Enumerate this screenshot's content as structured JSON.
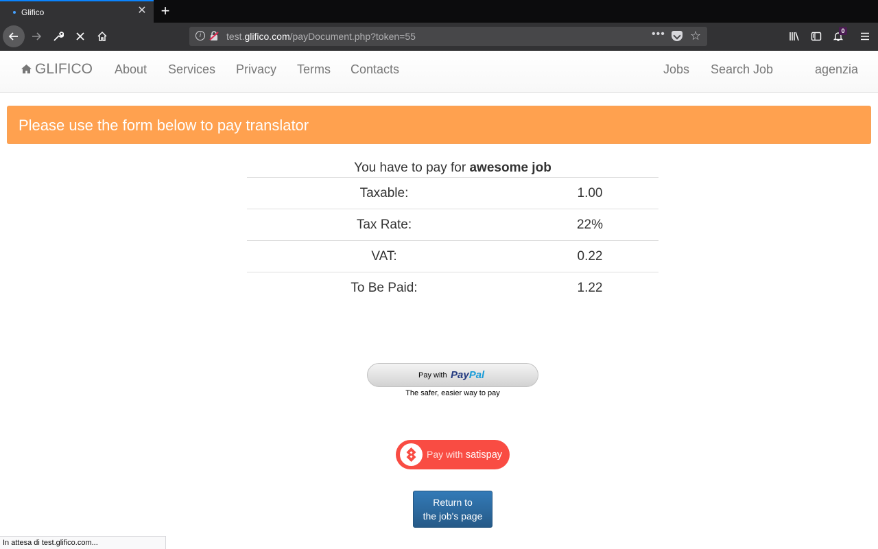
{
  "browser": {
    "tab_title": "Glifico",
    "url_prefix": "test.",
    "url_domain": "glifico.com",
    "url_path": "/payDocument.php?token=55",
    "notification_count": "0",
    "status_text": "In attesa di test.glifico.com..."
  },
  "nav": {
    "brand": "GLIFICO",
    "links": [
      "About",
      "Services",
      "Privacy",
      "Terms",
      "Contacts"
    ],
    "right_links": [
      "Jobs",
      "Search Job",
      "agenzia"
    ]
  },
  "alert": {
    "message": "Please use the form below to pay translator"
  },
  "payment": {
    "heading_prefix": "You have to pay for ",
    "job_name": "awesome job",
    "rows": [
      {
        "label": "Taxable:",
        "value": "1.00"
      },
      {
        "label": "Tax Rate:",
        "value": "22%"
      },
      {
        "label": "VAT:",
        "value": "0.22"
      },
      {
        "label": "To Be Paid:",
        "value": "1.22"
      }
    ]
  },
  "paypal": {
    "pay_with": "Pay with",
    "brand_pay": "Pay",
    "brand_pal": "Pal",
    "tagline": "The safer, easier way to pay"
  },
  "satispay": {
    "pay_with": "Pay with ",
    "brand": "satispay",
    "color": "#f94c43"
  },
  "return_button": {
    "line1": "Return to",
    "line2": "the job's page"
  },
  "colors": {
    "alert_bg": "#ffa14f",
    "primary_button": "#337ab7",
    "tab_accent": "#0a84ff"
  }
}
